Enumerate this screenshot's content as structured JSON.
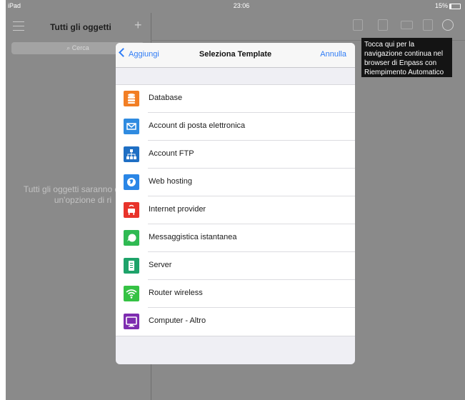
{
  "statusbar": {
    "device": "iPad",
    "time": "23:06",
    "battery": "15%"
  },
  "sidebar": {
    "title": "Tutti gli oggetti",
    "search_placeholder": "Cerca",
    "empty_message": "Tutti gli oggetti saranno qui con un'opzione di ri"
  },
  "tooltip": {
    "text": "Tocca qui per la navigazione continua nel browser di Enpass con Riempimento Automatico"
  },
  "modal": {
    "back_label": "Aggiungi",
    "title": "Seleziona Template",
    "cancel_label": "Annulla",
    "items": [
      {
        "label": "Database",
        "icon": "database-icon",
        "color": "#f27e24"
      },
      {
        "label": "Account di posta elettronica",
        "icon": "mail-icon",
        "color": "#2f8be0"
      },
      {
        "label": "Account FTP",
        "icon": "ftp-network-icon",
        "color": "#1f6fc4"
      },
      {
        "label": "Web hosting",
        "icon": "globe-icon",
        "color": "#2a86e6"
      },
      {
        "label": "Internet provider",
        "icon": "router-icon",
        "color": "#e8332a"
      },
      {
        "label": "Messaggistica istantanea",
        "icon": "chat-bubble-icon",
        "color": "#2fba52"
      },
      {
        "label": "Server",
        "icon": "server-icon",
        "color": "#1ea36a"
      },
      {
        "label": "Router wireless",
        "icon": "wifi-icon",
        "color": "#35c244"
      },
      {
        "label": "Computer - Altro",
        "icon": "computer-icon",
        "color": "#7e2db0"
      }
    ]
  }
}
